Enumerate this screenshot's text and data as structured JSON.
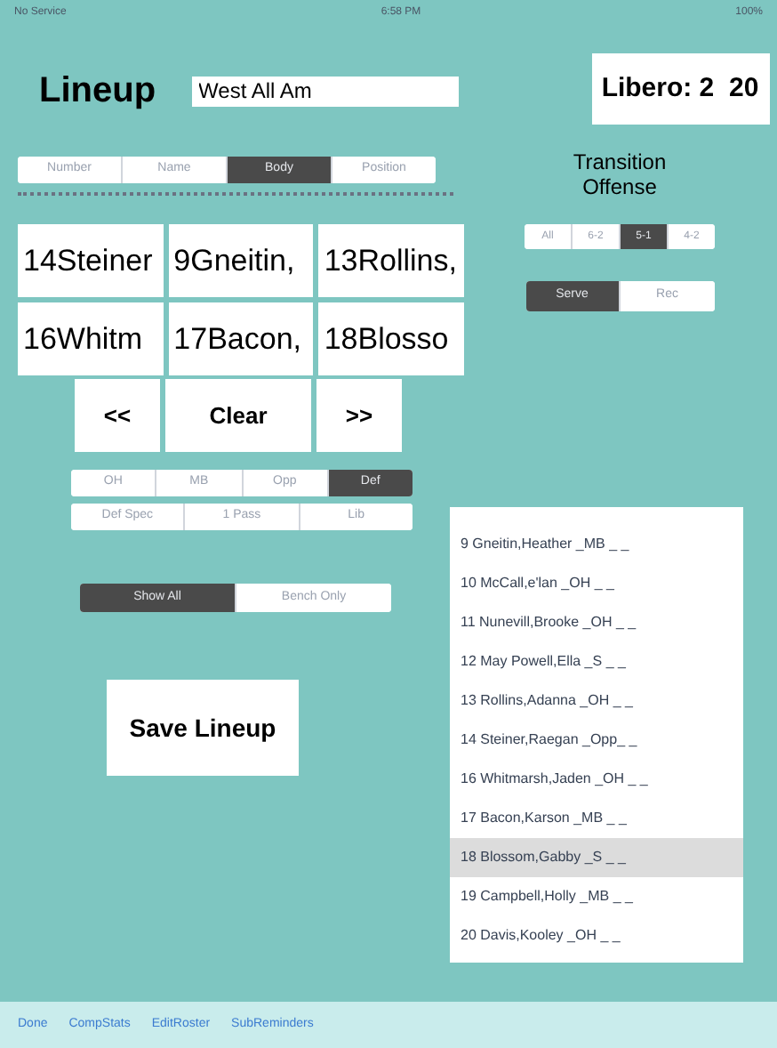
{
  "status_bar": {
    "carrier": "No Service",
    "time": "6:58 PM",
    "battery": "100%"
  },
  "title": "Lineup",
  "lineup_name": {
    "value": "West All Am"
  },
  "libero": "Libero: 2  20",
  "sort_tabs": [
    {
      "label": "Number",
      "selected": false
    },
    {
      "label": "Name",
      "selected": false
    },
    {
      "label": "Body",
      "selected": true
    },
    {
      "label": "Position",
      "selected": false
    }
  ],
  "lineup_slots": [
    "14Steiner",
    "9Gneitin,",
    "13Rollins,",
    "16Whitm",
    "17Bacon,",
    "18Blosso"
  ],
  "nav_buttons": [
    "<<",
    "Clear",
    ">>"
  ],
  "position_filters": [
    {
      "label": "OH",
      "selected": false
    },
    {
      "label": "MB",
      "selected": false
    },
    {
      "label": "Opp",
      "selected": false
    },
    {
      "label": "Def",
      "selected": true
    }
  ],
  "role_filters": [
    {
      "label": "Def Spec",
      "selected": false
    },
    {
      "label": "1 Pass",
      "selected": false
    },
    {
      "label": "Lib",
      "selected": false
    }
  ],
  "show_filter": [
    {
      "label": "Show All",
      "selected": true
    },
    {
      "label": "Bench Only",
      "selected": false
    }
  ],
  "save_button": "Save Lineup",
  "transition": {
    "label": "Transition Offense",
    "systems": [
      {
        "label": "All",
        "selected": false
      },
      {
        "label": "6-2",
        "selected": false
      },
      {
        "label": "5-1",
        "selected": true
      },
      {
        "label": "4-2",
        "selected": false
      }
    ],
    "serve": [
      {
        "label": "Serve",
        "selected": true
      },
      {
        "label": "Rec",
        "selected": false
      }
    ]
  },
  "roster": [
    {
      "label": "9 Gneitin,Heather _MB _ _",
      "selected": false
    },
    {
      "label": "10 McCall,e'lan _OH _ _",
      "selected": false
    },
    {
      "label": "11 Nunevill,Brooke _OH _ _",
      "selected": false
    },
    {
      "label": "12 May Powell,Ella _S _ _",
      "selected": false
    },
    {
      "label": "13 Rollins,Adanna _OH _ _",
      "selected": false
    },
    {
      "label": "14 Steiner,Raegan _Opp_ _",
      "selected": false
    },
    {
      "label": "16 Whitmarsh,Jaden _OH _ _",
      "selected": false
    },
    {
      "label": "17 Bacon,Karson _MB _ _",
      "selected": false
    },
    {
      "label": "18 Blossom,Gabby _S _ _",
      "selected": true
    },
    {
      "label": "19 Campbell,Holly _MB _ _",
      "selected": false
    },
    {
      "label": "20 Davis,Kooley _OH _ _",
      "selected": false
    }
  ],
  "toolbar": [
    "Done",
    "CompStats",
    "EditRoster",
    "SubReminders"
  ]
}
